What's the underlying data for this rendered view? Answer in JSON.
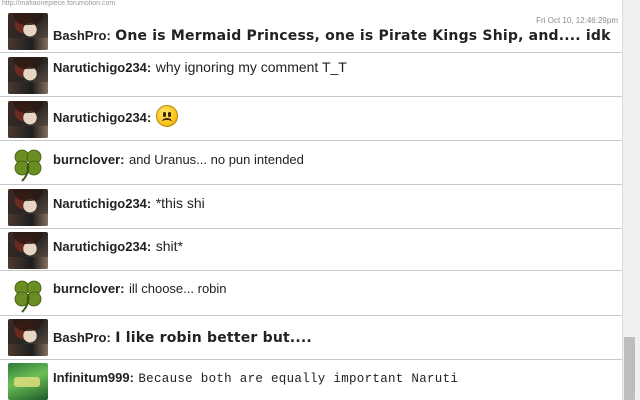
{
  "top_url": "http://mafiaonepiece.forumotion.com",
  "timestamp": "Fri Oct 10, 12:46:29pm",
  "messages": [
    {
      "user": "BashPro:",
      "text": "One is Mermaid Princess, one is Pirate Kings Ship, and.... idk",
      "avatar": "dark-avatar"
    },
    {
      "user": "Narutichigo234:",
      "text": "why ignoring my comment T_T",
      "avatar": "dark-avatar"
    },
    {
      "user": "Narutichigo234:",
      "text": "",
      "emoji": "sad-emoji",
      "avatar": "dark-avatar"
    },
    {
      "user": "burnclover:",
      "text": "and Uranus... no pun intended",
      "avatar": "clover-avatar"
    },
    {
      "user": "Narutichigo234:",
      "text": "*this shi",
      "avatar": "dark-avatar"
    },
    {
      "user": "Narutichigo234:",
      "text": "shit*",
      "avatar": "dark-avatar"
    },
    {
      "user": "burnclover:",
      "text": "ill choose... robin",
      "avatar": "clover-avatar"
    },
    {
      "user": "BashPro:",
      "text": "I like robin better but....",
      "avatar": "dark-avatar"
    },
    {
      "user": "Infinitum999:",
      "text": "Because both are equally important Naruti",
      "avatar": "green-avatar"
    }
  ],
  "colors": {
    "background": "#ffffff",
    "divider": "#c8c8c8",
    "clover": "#6b8e23"
  }
}
